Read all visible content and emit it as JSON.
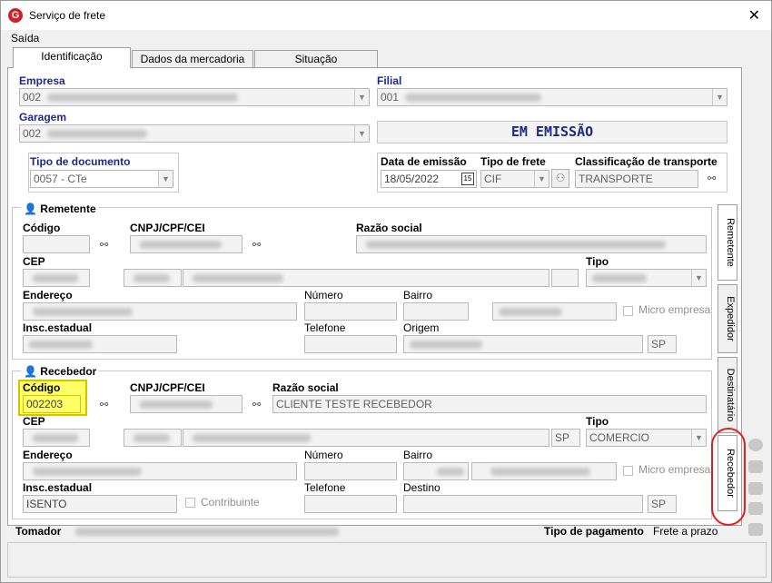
{
  "window": {
    "title": "Serviço de frete",
    "logo_letter": "G"
  },
  "menu": {
    "item": "Saída"
  },
  "tabs": [
    "Identificação",
    "Dados da mercadoria",
    "Situação"
  ],
  "identificacao": {
    "empresa_label": "Empresa",
    "empresa_value": "002",
    "filial_label": "Filial",
    "filial_value": "001",
    "garagem_label": "Garagem",
    "garagem_value": "002",
    "status_text": "EM EMISSÃO",
    "tipo_documento_label": "Tipo de documento",
    "tipo_documento_value": "0057 - CTe",
    "data_emissao_label": "Data de emissão",
    "data_emissao_value": "18/05/2022",
    "calendar_label": "15",
    "tipo_frete_label": "Tipo de frete",
    "tipo_frete_value": "CIF",
    "classificacao_label": "Classificação de transporte",
    "classificacao_value": "TRANSPORTE"
  },
  "remetente": {
    "title": "Remetente",
    "codigo_label": "Código",
    "cnpj_label": "CNPJ/CPF/CEI",
    "razao_label": "Razão social",
    "cep_label": "CEP",
    "tipo_label": "Tipo",
    "endereco_label": "Endereço",
    "numero_label": "Número",
    "bairro_label": "Bairro",
    "micro_empresa_label": "Micro empresa",
    "insc_label": "Insc.estadual",
    "telefone_label": "Telefone",
    "origem_label": "Origem",
    "uf_value": "SP"
  },
  "recebedor": {
    "title": "Recebedor",
    "codigo_label": "Código",
    "codigo_value": "002203",
    "cnpj_label": "CNPJ/CPF/CEI",
    "razao_label": "Razão social",
    "razao_value": "CLIENTE TESTE RECEBEDOR",
    "cep_label": "CEP",
    "cep_uf_value": "SP",
    "tipo_label": "Tipo",
    "tipo_value": "COMERCIO",
    "endereco_label": "Endereço",
    "numero_label": "Número",
    "bairro_label": "Bairro",
    "micro_empresa_label": "Micro empresa",
    "insc_label": "Insc.estadual",
    "insc_value": "ISENTO",
    "contribuinte_label": "Contribuinte",
    "telefone_label": "Telefone",
    "destino_label": "Destino",
    "uf_value": "SP"
  },
  "side_tabs": [
    "Remetente",
    "Expedidor",
    "Destinatário",
    "Recebedor"
  ],
  "footer": {
    "tomador_label": "Tomador",
    "tipo_pagamento_label": "Tipo de pagamento",
    "tipo_pagamento_value": "Frete a prazo"
  },
  "colors": {
    "highlight": "#ffff66",
    "annotation": "#e02020",
    "label_blue": "#1a2a8a"
  },
  "icons": [
    "binoculars-icon",
    "calendar-icon",
    "person-icon",
    "close-icon",
    "dropdown-arrow-icon"
  ]
}
